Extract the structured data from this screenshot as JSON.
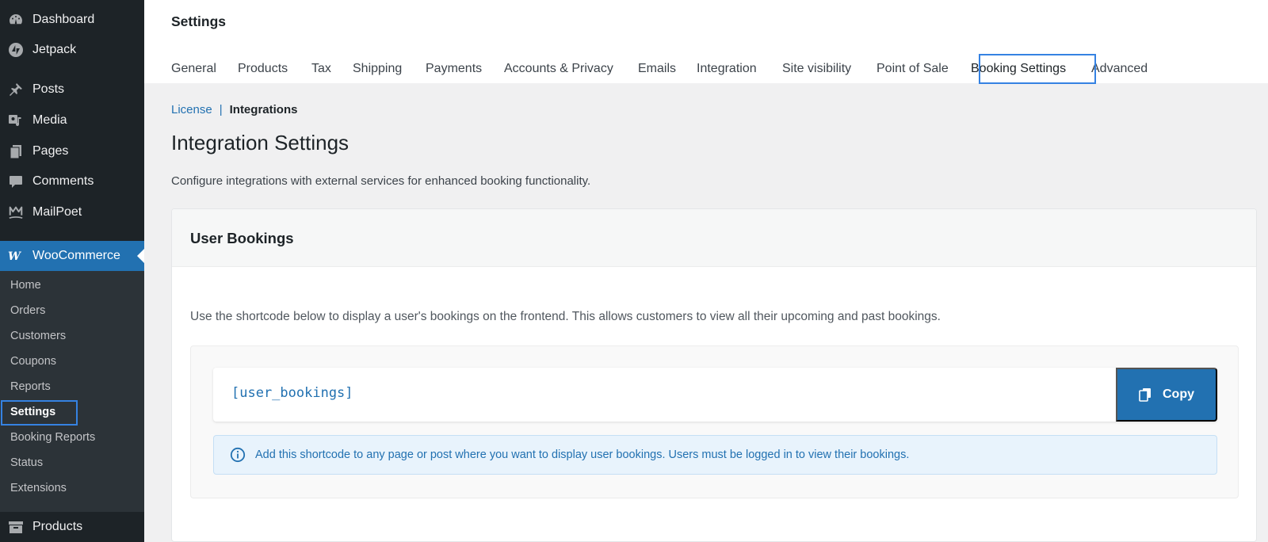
{
  "sidebar": {
    "top_items": [
      {
        "label": "Dashboard",
        "icon": "dashboard-icon"
      },
      {
        "label": "Jetpack",
        "icon": "jetpack-icon"
      },
      {
        "label": "Posts",
        "icon": "pin-icon"
      },
      {
        "label": "Media",
        "icon": "media-icon"
      },
      {
        "label": "Pages",
        "icon": "pages-icon"
      },
      {
        "label": "Comments",
        "icon": "comments-icon"
      },
      {
        "label": "MailPoet",
        "icon": "mailpoet-icon"
      }
    ],
    "woocommerce": {
      "label": "WooCommerce",
      "icon": "woocommerce-icon"
    },
    "submenu": [
      {
        "label": "Home"
      },
      {
        "label": "Orders"
      },
      {
        "label": "Customers"
      },
      {
        "label": "Coupons"
      },
      {
        "label": "Reports"
      },
      {
        "label": "Settings",
        "current": true
      },
      {
        "label": "Booking Reports"
      },
      {
        "label": "Status"
      },
      {
        "label": "Extensions"
      }
    ],
    "bottom_item": {
      "label": "Products",
      "icon": "archive-icon"
    }
  },
  "header": {
    "title": "Settings",
    "tabs": [
      {
        "label": "General"
      },
      {
        "label": "Products"
      },
      {
        "label": "Tax"
      },
      {
        "label": "Shipping"
      },
      {
        "label": "Payments"
      },
      {
        "label": "Accounts & Privacy"
      },
      {
        "label": "Emails"
      },
      {
        "label": "Integration"
      },
      {
        "label": "Site visibility"
      },
      {
        "label": "Point of Sale"
      },
      {
        "label": "Booking Settings",
        "active": true
      },
      {
        "label": "Advanced"
      }
    ]
  },
  "breadcrumb": {
    "link": "License",
    "separator": "|",
    "current": "Integrations"
  },
  "main": {
    "title": "Integration Settings",
    "description": "Configure integrations with external services for enhanced booking functionality.",
    "card": {
      "title": "User Bookings",
      "description": "Use the shortcode below to display a user's bookings on the frontend. This allows customers to view all their upcoming and past bookings.",
      "shortcode": "[user_bookings]",
      "copy_label": "Copy",
      "notice": "Add this shortcode to any page or post where you want to display user bookings. Users must be logged in to view their bookings."
    }
  },
  "colors": {
    "sidebar_bg": "#1d2327",
    "submenu_bg": "#2c3338",
    "accent": "#2271b1",
    "focus": "#3582e2",
    "notice_bg": "#e8f3fc"
  }
}
